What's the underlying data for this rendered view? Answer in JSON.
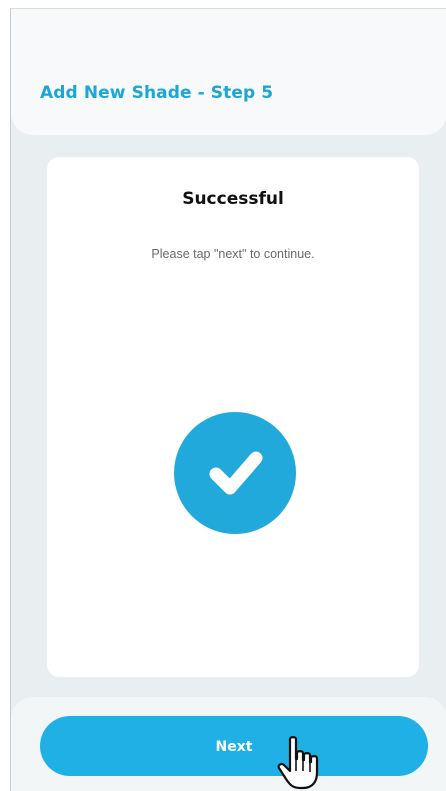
{
  "header": {
    "title": "Add New Shade - Step 5"
  },
  "card": {
    "title": "Successful",
    "subtitle": "Please tap \"next\" to continue."
  },
  "status_icon": "checkmark-icon",
  "footer": {
    "next_label": "Next"
  },
  "colors": {
    "accent": "#1fb1e6",
    "title": "#1aa6d6",
    "background": "#e9eef0"
  }
}
